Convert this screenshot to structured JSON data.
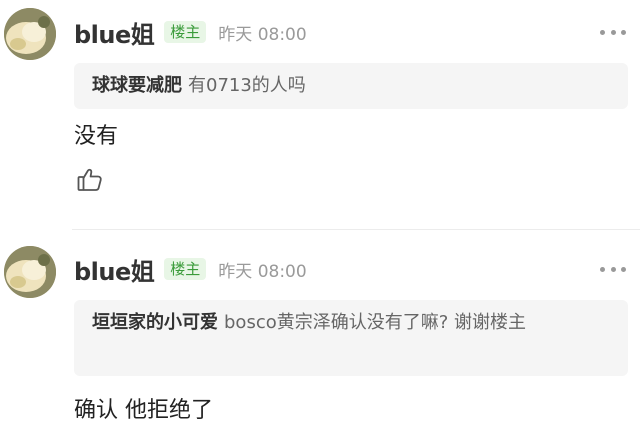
{
  "posts": [
    {
      "username": "blue姐",
      "badge": "楼主",
      "time": "昨天 08:00",
      "quote_author": "球球要减肥",
      "quote_text": "有0713的人吗",
      "content": "没有"
    },
    {
      "username": "blue姐",
      "badge": "楼主",
      "time": "昨天 08:00",
      "quote_author": "垣垣家的小可爱",
      "quote_text": "bosco黄宗泽确认没有了嘛? 谢谢楼主",
      "content": "确认 他拒绝了"
    }
  ],
  "icons": {
    "more": "more-icon",
    "like": "thumbs-up-icon"
  }
}
